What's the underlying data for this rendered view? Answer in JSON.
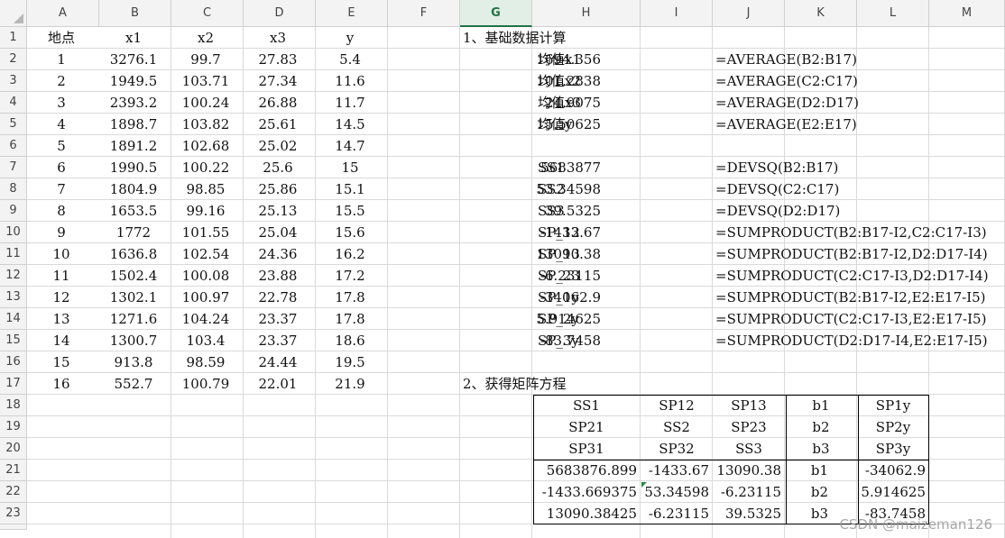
{
  "columns": [
    "A",
    "B",
    "C",
    "D",
    "E",
    "F",
    "G",
    "H",
    "I",
    "J",
    "K",
    "L",
    "M"
  ],
  "selected_column": "G",
  "rows": [
    "1",
    "2",
    "3",
    "4",
    "5",
    "6",
    "7",
    "8",
    "9",
    "10",
    "11",
    "12",
    "13",
    "14",
    "15",
    "16",
    "17",
    "18",
    "19",
    "20",
    "21",
    "22",
    "23"
  ],
  "data_table": {
    "headers": [
      "地点",
      "x1",
      "x2",
      "x3",
      "y"
    ],
    "rows": [
      [
        "1",
        "3276.1",
        "99.7",
        "27.83",
        "5.4"
      ],
      [
        "2",
        "1949.5",
        "103.71",
        "27.34",
        "11.6"
      ],
      [
        "3",
        "2393.2",
        "100.24",
        "26.88",
        "11.7"
      ],
      [
        "4",
        "1898.7",
        "103.82",
        "25.61",
        "14.5"
      ],
      [
        "5",
        "1891.2",
        "102.68",
        "25.02",
        "14.7"
      ],
      [
        "6",
        "1990.5",
        "100.22",
        "25.6",
        "15"
      ],
      [
        "7",
        "1804.9",
        "98.85",
        "25.86",
        "15.1"
      ],
      [
        "8",
        "1653.5",
        "99.16",
        "25.13",
        "15.5"
      ],
      [
        "9",
        "1772",
        "101.55",
        "25.04",
        "15.6"
      ],
      [
        "10",
        "1636.8",
        "102.54",
        "24.36",
        "16.2"
      ],
      [
        "11",
        "1502.4",
        "100.08",
        "23.88",
        "17.2"
      ],
      [
        "12",
        "1302.1",
        "100.97",
        "22.78",
        "17.8"
      ],
      [
        "13",
        "1271.6",
        "104.24",
        "23.37",
        "17.8"
      ],
      [
        "14",
        "1300.7",
        "103.4",
        "23.37",
        "18.6"
      ],
      [
        "15",
        "913.8",
        "98.59",
        "24.44",
        "19.5"
      ],
      [
        "16",
        "552.7",
        "100.79",
        "22.01",
        "21.9"
      ]
    ]
  },
  "section1": {
    "title": "1、基础数据计算",
    "means": [
      {
        "label": "均值x1",
        "value": "1694.356",
        "formula": "=AVERAGE(B2:B17)"
      },
      {
        "label": "均值x2",
        "value": "101.2838",
        "formula": "=AVERAGE(C2:C17)"
      },
      {
        "label": "均值x3",
        "value": "24.9075",
        "formula": "=AVERAGE(D2:D17)"
      },
      {
        "label": "均值y",
        "value": "15.50625",
        "formula": "=AVERAGE(E2:E17)"
      }
    ],
    "stats": [
      {
        "label": "SS1",
        "value": "5683877",
        "formula": "=DEVSQ(B2:B17)"
      },
      {
        "label": "SS2",
        "value": "53.34598",
        "formula": "=DEVSQ(C2:C17)"
      },
      {
        "label": "SS3",
        "value": "39.5325",
        "formula": "=DEVSQ(D2:D17)"
      },
      {
        "label": "SP_12",
        "value": "-1433.67",
        "formula": "=SUMPRODUCT(B2:B17-I2,C2:C17-I3)"
      },
      {
        "label": "SP_13",
        "value": "13090.38",
        "formula": "=SUMPRODUCT(B2:B17-I2,D2:D17-I4)"
      },
      {
        "label": "SP_23",
        "value": "-6.23115",
        "formula": "=SUMPRODUCT(C2:C17-I3,D2:D17-I4)"
      },
      {
        "label": "SP_1y",
        "value": "-34062.9",
        "formula": "=SUMPRODUCT(B2:B17-I2,E2:E17-I5)"
      },
      {
        "label": "SP_2y",
        "value": "5.914625",
        "formula": "=SUMPRODUCT(C2:C17-I3,E2:E17-I5)"
      },
      {
        "label": "SP_3y",
        "value": "-83.7458",
        "formula": "=SUMPRODUCT(D2:D17-I4,E2:E17-I5)"
      }
    ]
  },
  "section2": {
    "title": "2、获得矩阵方程",
    "symbolic": [
      [
        "SS1",
        "SP12",
        "SP13",
        "b1",
        "SP1y"
      ],
      [
        "SP21",
        "SS2",
        "SP23",
        "b2",
        "SP2y"
      ],
      [
        "SP31",
        "SP32",
        "SS3",
        "b3",
        "SP3y"
      ]
    ],
    "numeric": [
      [
        "5683876.899",
        "-1433.67",
        "13090.38",
        "b1",
        "-34062.9"
      ],
      [
        "-1433.669375",
        "53.34598",
        "-6.23115",
        "b2",
        "5.914625"
      ],
      [
        "13090.38425",
        "-6.23115",
        "39.5325",
        "b3",
        "-83.7458"
      ]
    ]
  },
  "watermark": "CSDN @maizeman126"
}
